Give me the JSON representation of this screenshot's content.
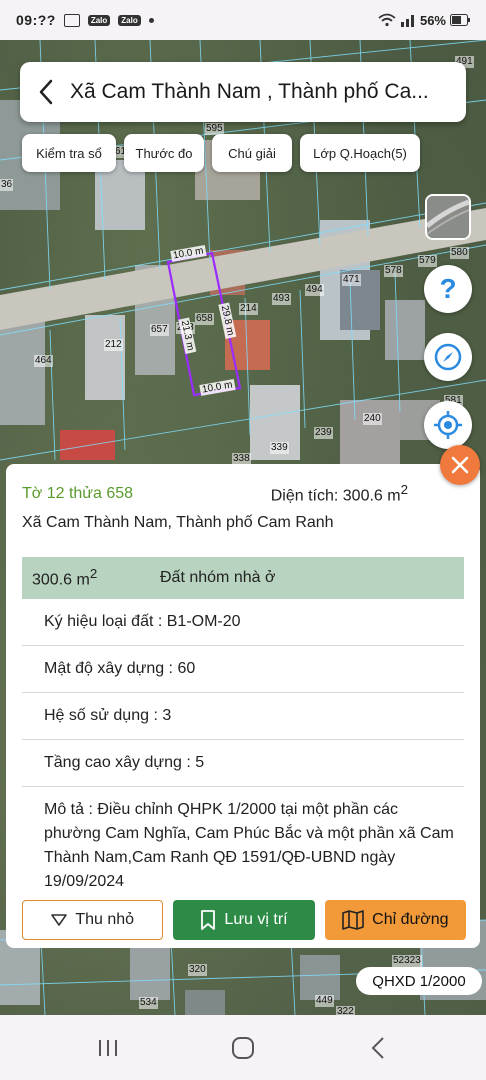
{
  "status_bar": {
    "time": "09:??",
    "badges": [
      "Zalo",
      "Zalo"
    ],
    "right_text": "56%",
    "icons": [
      "image-icon",
      "zalo-icon",
      "zalo-icon",
      "dot-icon",
      "wifi-icon",
      "signal-icon",
      "battery-icon"
    ]
  },
  "header": {
    "back_icon": "chevron-left-icon",
    "title": "Xã Cam Thành Nam , Thành phố Ca..."
  },
  "chips": {
    "check": "Kiểm tra sổ",
    "measure": "Thước đo",
    "legend": "Chú giải",
    "planning_layer": "Lớp Q.Hoạch(5)"
  },
  "map": {
    "parcel_numbers": [
      "491",
      "595",
      "61",
      "36",
      "580",
      "579",
      "578",
      "494",
      "471",
      "493",
      "214",
      "658",
      "657",
      "213",
      "212",
      "464",
      "240",
      "239",
      "339",
      "338",
      "581",
      "320",
      "534",
      "449",
      "322",
      "52323"
    ],
    "dimensions": [
      "10.0 m",
      "29.8 m",
      "21.3 m",
      "10.0 m"
    ]
  },
  "floating_buttons": {
    "layers": "layers-icon",
    "help": "?",
    "compass": "compass-icon",
    "locate": "locate-icon",
    "close": "close-icon"
  },
  "info": {
    "parcel_id": "Tờ 12 thửa 658",
    "area_label": "Diện tích: 300.6 m",
    "area_sup": "2",
    "address": "Xã Cam Thành Nam, Thành phố Cam Ranh",
    "zone_area": "300.6 m",
    "zone_sup": "2",
    "zone_type": "Đất nhóm nhà ở",
    "land_code": "Ký hiệu loại đất : B1-OM-20",
    "density": "Mật độ xây dựng : 60",
    "usage_coef": "Hệ số sử dụng : 3",
    "floors": "Tầng cao xây dựng : 5",
    "description": "Mô tả : Điều chỉnh QHPK 1/2000 tại một phần các phường Cam Nghĩa, Cam Phúc Bắc và một phần xã Cam Thành Nam,Cam Ranh QĐ 1591/QĐ-UBND ngày 19/09/2024"
  },
  "actions": {
    "shrink": "Thu nhỏ",
    "save": "Lưu vị trí",
    "directions": "Chỉ đường"
  },
  "scale": "QHXD 1/2000",
  "nav": [
    "recents-icon",
    "home-icon",
    "back-icon"
  ],
  "colors": {
    "accent_green": "#2e8b47",
    "accent_orange": "#f2993a",
    "close_orange": "#f07a3e",
    "parcel_purple": "#8a2be2",
    "zone_row": "#b8d4c0",
    "parcel_text_green": "#5a9a2c"
  }
}
